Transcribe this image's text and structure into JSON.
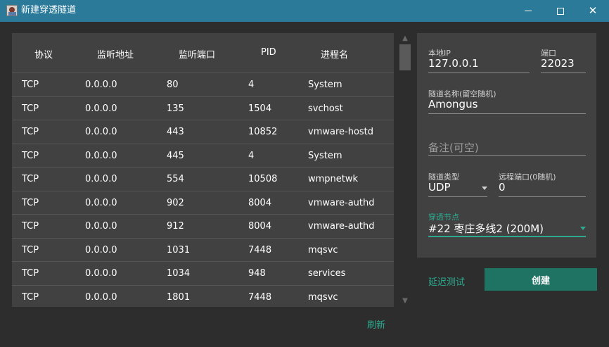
{
  "window": {
    "title": "新建穿透隧道",
    "icon": "app-avatar-icon"
  },
  "table": {
    "headers": [
      "协议",
      "监听地址",
      "监听端口",
      "PID",
      "进程名"
    ],
    "rows": [
      [
        "TCP",
        "0.0.0.0",
        "80",
        "4",
        "System"
      ],
      [
        "TCP",
        "0.0.0.0",
        "135",
        "1504",
        "svchost"
      ],
      [
        "TCP",
        "0.0.0.0",
        "443",
        "10852",
        "vmware-hostd"
      ],
      [
        "TCP",
        "0.0.0.0",
        "445",
        "4",
        "System"
      ],
      [
        "TCP",
        "0.0.0.0",
        "554",
        "10508",
        "wmpnetwk"
      ],
      [
        "TCP",
        "0.0.0.0",
        "902",
        "8004",
        "vmware-authd"
      ],
      [
        "TCP",
        "0.0.0.0",
        "912",
        "8004",
        "vmware-authd"
      ],
      [
        "TCP",
        "0.0.0.0",
        "1031",
        "7448",
        "mqsvc"
      ],
      [
        "TCP",
        "0.0.0.0",
        "1034",
        "948",
        "services"
      ],
      [
        "TCP",
        "0.0.0.0",
        "1801",
        "7448",
        "mqsvc"
      ]
    ]
  },
  "refresh_label": "刷新",
  "form": {
    "local_ip": {
      "label": "本地IP",
      "value": "127.0.0.1"
    },
    "port": {
      "label": "端口",
      "value": "22023"
    },
    "tunnel_name": {
      "label": "隧道名称(留空随机)",
      "value": "Amongus"
    },
    "note": {
      "placeholder": "备注(可空)"
    },
    "tunnel_type": {
      "label": "隧道类型",
      "value": "UDP"
    },
    "remote_port": {
      "label": "远程端口(0随机)",
      "value": "0"
    },
    "node": {
      "label": "穿透节点",
      "value": "#22 枣庄多线2 (200M)"
    }
  },
  "latency_test_label": "延迟测试",
  "create_label": "创建",
  "colors": {
    "titlebar": "#2b7a9a",
    "background": "#2d2d2d",
    "card": "#414141",
    "accent": "#2aa98e",
    "button": "#1f7363"
  }
}
